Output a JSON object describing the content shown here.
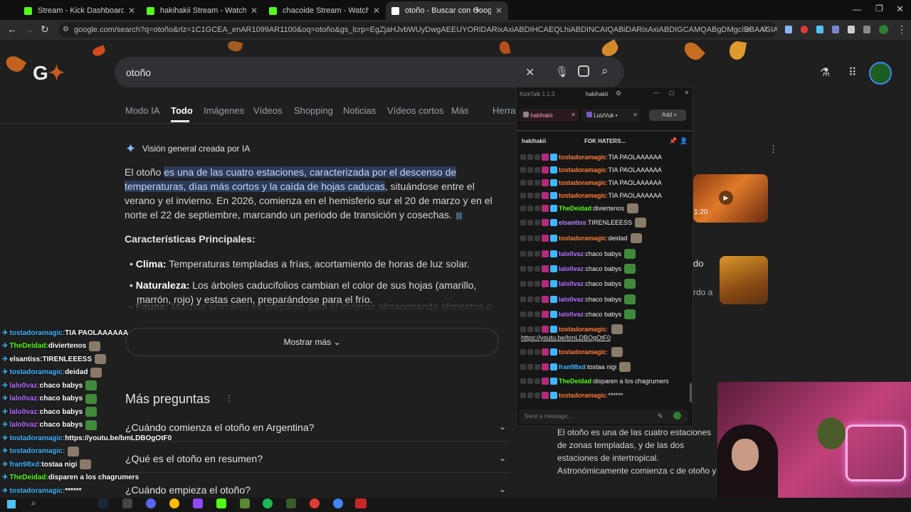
{
  "browser": {
    "tabs": [
      {
        "title": "Stream - Kick Dashboard",
        "active": false,
        "color": "#53fc18"
      },
      {
        "title": "hakihakii Stream - Watch Live o",
        "active": false,
        "color": "#53fc18"
      },
      {
        "title": "chacoide Stream - Watch Live o",
        "active": false,
        "color": "#53fc18"
      },
      {
        "title": "otoño - Buscar con Google",
        "active": true,
        "color": "#ffffff"
      }
    ],
    "url": "google.com/search?q=otoño&rlz=1C1GCEA_enAR1099AR1100&oq=otoño&gs_lcrp=EgZjaHJvbWUyDwgAEEUYORiDARixAxiABDIHCAEQLhiABDINCAIQABiDARixAxiABDIGCAMQABgDMgcIBBAAGIAEMg0IBRAAGIMBGLEDGIAE..."
  },
  "google": {
    "query": "otoño",
    "tabs": [
      "Modo IA",
      "Todo",
      "Imágenes",
      "Vídeos",
      "Shopping",
      "Noticias",
      "Vídeos cortos",
      "Más",
      "Herra"
    ],
    "ai_heading": "Visión general creada por IA",
    "ai_p1_pre": "El otoño ",
    "ai_p1_hl": "es una de las cuatro estaciones, caracterizada por el descenso de temperaturas, días más cortos y la caída de hojas caducas",
    "ai_p1_post": ", situándose entre el verano y el invierno. En 2026, comienza en el hemisferio sur el 20 de marzo y en el norte el 22 de septiembre, marcando un periodo de transición y cosechas.",
    "features_heading": "Características Principales:",
    "bullets": [
      {
        "b": "Clima:",
        "t": " Temperaturas templadas a frías, acortamiento de horas de luz solar."
      },
      {
        "b": "Naturaleza:",
        "t": " Los árboles caducifolios cambian el color de sus hojas (amarillo, marrón, rojo) y estas caen, preparándose para el frío."
      },
      {
        "b": "Fauna:",
        "t": " Muchos animales se preparan para el invierno almacenando alimentos o"
      }
    ],
    "show_more": "Mostrar más",
    "more_q_heading": "Más preguntas",
    "questions": [
      "¿Cuándo comienza el otoño en Argentina?",
      "¿Qué es el otoño en resumen?",
      "¿Cuándo empieza el otoño?"
    ],
    "video_duration": "1:20",
    "right_snippet_1": "do",
    "right_snippet_2": "rdo a",
    "knowledge_text": "El otoño es una de las cuatro estaciones de zonas templadas, y de las dos estaciones de intertropical. Astronómicamente comienza c de otoño y termina con el solsticio de invier"
  },
  "kicktalk": {
    "app": "KickTalk 1.1.3",
    "user": "hakihakii",
    "tabs": [
      "hakihakii",
      "LuizVuk"
    ],
    "add": "Add",
    "channel": "hakihakii",
    "pinned": "FOK HATERS...",
    "placeholder": "Send a message...",
    "messages": [
      {
        "u": "tostadoramagic",
        "c": "#ff7b3a",
        "t": "TIA PAOLAAAAAA"
      },
      {
        "u": "tostadoramagic",
        "c": "#ff7b3a",
        "t": "TIA PAOLAAAAAA"
      },
      {
        "u": "tostadoramagic",
        "c": "#ff7b3a",
        "t": "TIA PAOLAAAAAA"
      },
      {
        "u": "tostadoramagic",
        "c": "#ff7b3a",
        "t": "TIA PAOLAAAAAA"
      },
      {
        "u": "TheDeidad",
        "c": "#53fc18",
        "t": "diviertenos"
      },
      {
        "u": "elsantiss",
        "c": "#b184ff",
        "t": "TIRENLEEESS"
      },
      {
        "u": "tostadoramagic",
        "c": "#ff7b3a",
        "t": "deidad"
      },
      {
        "u": "lalo0vaz",
        "c": "#b16cff",
        "t": "chaco babys"
      },
      {
        "u": "lalo0vaz",
        "c": "#b16cff",
        "t": "chaco babys"
      },
      {
        "u": "lalo0vaz",
        "c": "#b16cff",
        "t": "chaco babys"
      },
      {
        "u": "lalo0vaz",
        "c": "#b16cff",
        "t": "chaco babys"
      },
      {
        "u": "lalo0vaz",
        "c": "#b16cff",
        "t": "chaco babys"
      },
      {
        "u": "tostadoramagic",
        "c": "#ff7b3a",
        "t": ""
      },
      {
        "u": "tostadoramagic",
        "c": "#ff7b3a",
        "t": ""
      },
      {
        "u": "fran98xd",
        "c": "#3fb6ff",
        "t": "tostaa nigi"
      },
      {
        "u": "TheDeidad",
        "c": "#53fc18",
        "t": "disparen a los chagrumers"
      },
      {
        "u": "tostadoramagic",
        "c": "#ff7b3a",
        "t": "******"
      }
    ],
    "link": "https://youtu.be/bmLDBOgOtF0"
  },
  "overlay": {
    "messages": [
      {
        "u": "tostadoramagic",
        "c": "#3fb6ff",
        "t": "TIA PAOLAAAAAA"
      },
      {
        "u": "TheDeidad",
        "c": "#53fc18",
        "t": "diviertenos"
      },
      {
        "u": "elsantiss",
        "c": "#ffffff",
        "t": "TIRENLEEESS"
      },
      {
        "u": "tostadoramagic",
        "c": "#3fb6ff",
        "t": "deidad"
      },
      {
        "u": "lalo0vaz",
        "c": "#b16cff",
        "t": "chaco babys"
      },
      {
        "u": "lalo0vaz",
        "c": "#b16cff",
        "t": "chaco babys"
      },
      {
        "u": "lalo0vaz",
        "c": "#b16cff",
        "t": "chaco babys"
      },
      {
        "u": "lalo0vaz",
        "c": "#b16cff",
        "t": "chaco babys"
      },
      {
        "u": "tostadoramagic",
        "c": "#3fb6ff",
        "t": "https://youtu.be/bmLDBOgOtF0"
      },
      {
        "u": "tostadoramagic",
        "c": "#3fb6ff",
        "t": ""
      },
      {
        "u": "fran98xd",
        "c": "#3fb6ff",
        "t": "tostaa nigi"
      },
      {
        "u": "TheDeidad",
        "c": "#53fc18",
        "t": "disparen a los chagrumers"
      },
      {
        "u": "tostadoramagic",
        "c": "#3fb6ff",
        "t": "******"
      }
    ]
  }
}
